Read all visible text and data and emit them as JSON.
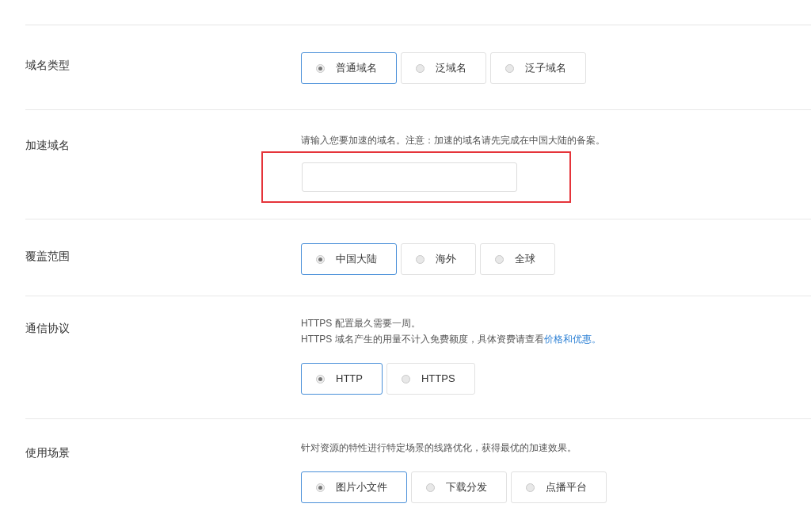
{
  "rows": [
    {
      "label": "域名类型",
      "kind": "radio",
      "notes": [],
      "options": [
        {
          "label": "普通域名",
          "selected": true
        },
        {
          "label": "泛域名",
          "selected": false
        },
        {
          "label": "泛子域名",
          "selected": false
        }
      ]
    },
    {
      "label": "加速域名",
      "kind": "input",
      "notes": [
        {
          "text": "请输入您要加速的域名。注意：加速的域名请先完成在中国大陆的备案。"
        }
      ],
      "field": {
        "highlighted": true
      }
    },
    {
      "label": "覆盖范围",
      "kind": "radio",
      "notes": [],
      "options": [
        {
          "label": "中国大陆",
          "selected": true
        },
        {
          "label": "海外",
          "selected": false
        },
        {
          "label": "全球",
          "selected": false
        }
      ]
    },
    {
      "label": "通信协议",
      "kind": "radio",
      "notes": [
        {
          "text": "HTTPS 配置最久需要一周。"
        },
        {
          "text": "HTTPS 域名产生的用量不计入免费额度，具体资费请查看",
          "link": "价格和优惠。"
        }
      ],
      "options": [
        {
          "label": "HTTP",
          "selected": true
        },
        {
          "label": "HTTPS",
          "selected": false
        }
      ]
    },
    {
      "label": "使用场景",
      "kind": "radio",
      "notes": [
        {
          "text": "针对资源的特性进行特定场景的线路优化，获得最优的加速效果。"
        }
      ],
      "options": [
        {
          "label": "图片小文件",
          "selected": true
        },
        {
          "label": "下载分发",
          "selected": false
        },
        {
          "label": "点播平台",
          "selected": false
        }
      ]
    }
  ]
}
